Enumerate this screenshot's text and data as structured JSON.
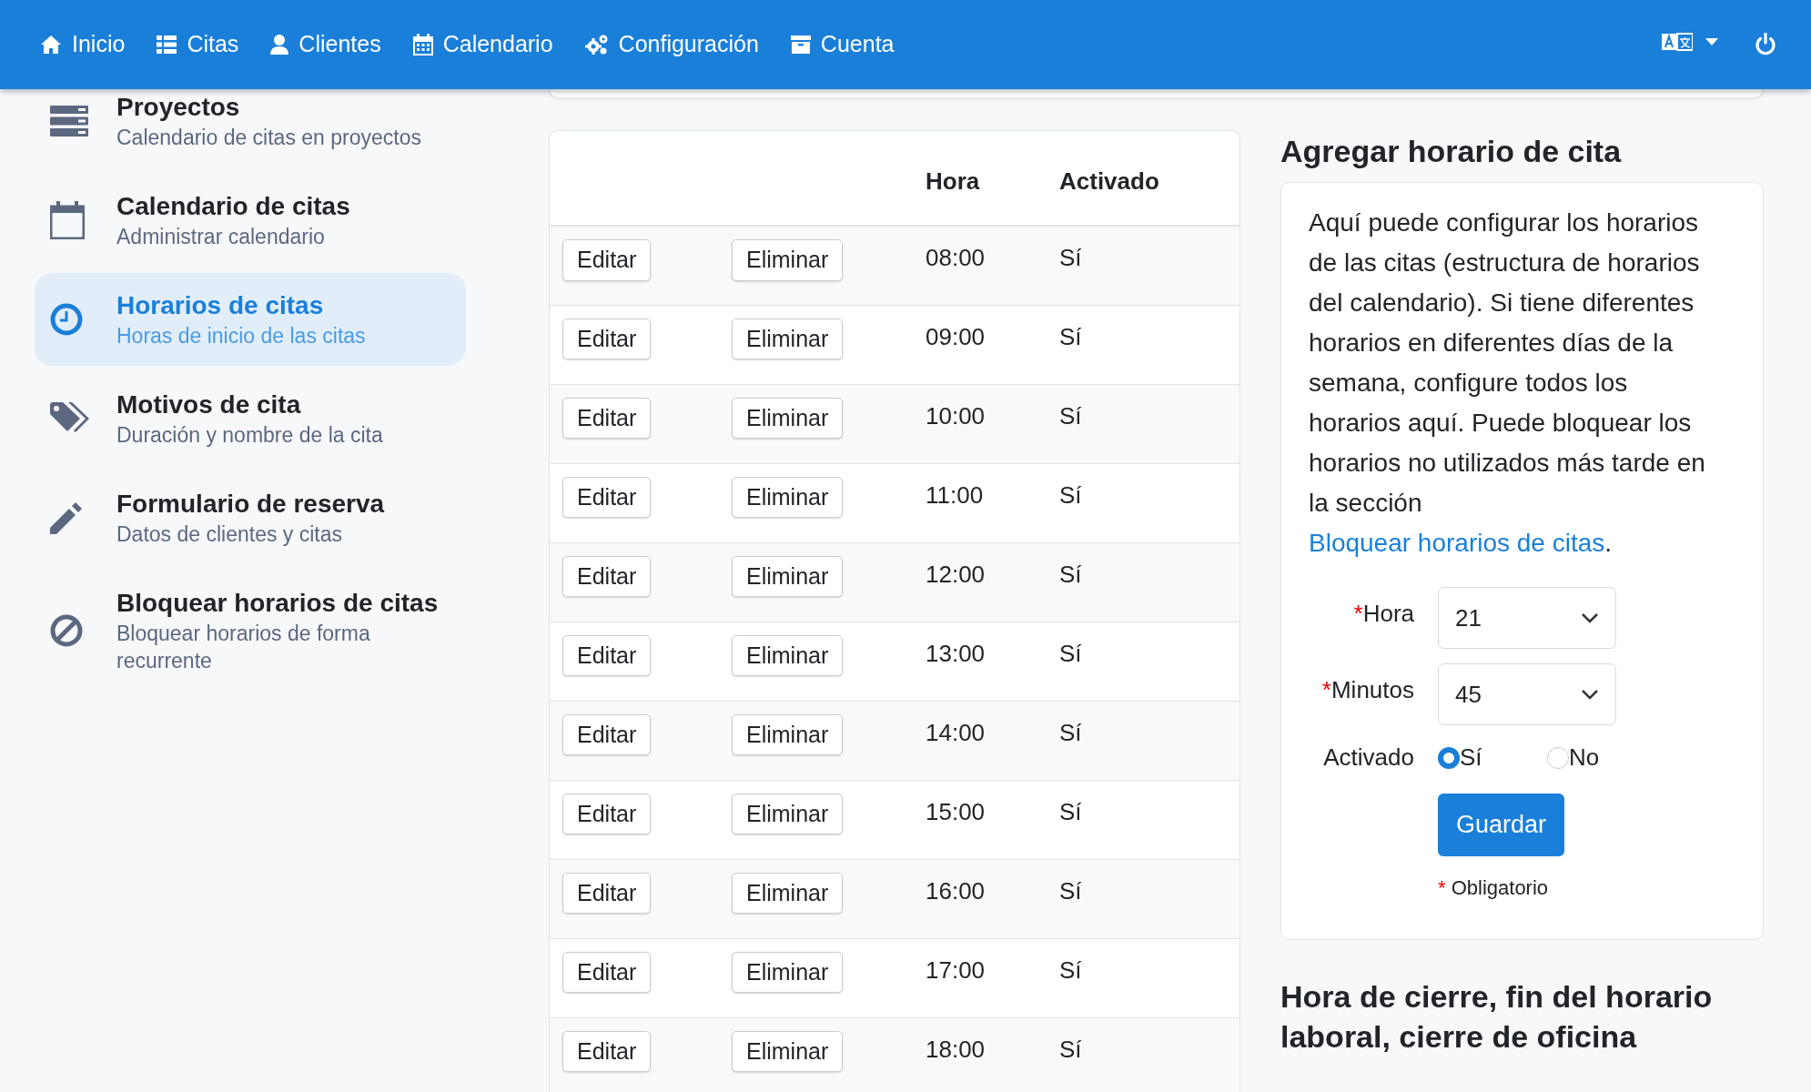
{
  "navbar": {
    "items": [
      {
        "label": "Inicio"
      },
      {
        "label": "Citas"
      },
      {
        "label": "Clientes"
      },
      {
        "label": "Calendario"
      },
      {
        "label": "Configuración"
      },
      {
        "label": "Cuenta"
      }
    ]
  },
  "sidebar": {
    "items": [
      {
        "title": "Proyectos",
        "subtitle": "Calendario de citas en proyectos",
        "selected": false
      },
      {
        "title": "Calendario de citas",
        "subtitle": "Administrar calendario",
        "selected": false
      },
      {
        "title": "Horarios de citas",
        "subtitle": "Horas de inicio de las citas",
        "selected": true
      },
      {
        "title": "Motivos de cita",
        "subtitle": "Duración y nombre de la cita",
        "selected": false
      },
      {
        "title": "Formulario de reserva",
        "subtitle": "Datos de clientes y citas",
        "selected": false
      },
      {
        "title": "Bloquear horarios de citas",
        "subtitle": "Bloquear horarios de forma recurrente",
        "selected": false
      }
    ]
  },
  "table": {
    "columns": [
      "Hora",
      "Activado"
    ],
    "rows": [
      {
        "edit": "Editar",
        "delete": "Eliminar",
        "hora": "08:00",
        "activado": "Sí"
      },
      {
        "edit": "Editar",
        "delete": "Eliminar",
        "hora": "09:00",
        "activado": "Sí"
      },
      {
        "edit": "Editar",
        "delete": "Eliminar",
        "hora": "10:00",
        "activado": "Sí"
      },
      {
        "edit": "Editar",
        "delete": "Eliminar",
        "hora": "11:00",
        "activado": "Sí"
      },
      {
        "edit": "Editar",
        "delete": "Eliminar",
        "hora": "12:00",
        "activado": "Sí"
      },
      {
        "edit": "Editar",
        "delete": "Eliminar",
        "hora": "13:00",
        "activado": "Sí"
      },
      {
        "edit": "Editar",
        "delete": "Eliminar",
        "hora": "14:00",
        "activado": "Sí"
      },
      {
        "edit": "Editar",
        "delete": "Eliminar",
        "hora": "15:00",
        "activado": "Sí"
      },
      {
        "edit": "Editar",
        "delete": "Eliminar",
        "hora": "16:00",
        "activado": "Sí"
      },
      {
        "edit": "Editar",
        "delete": "Eliminar",
        "hora": "17:00",
        "activado": "Sí"
      },
      {
        "edit": "Editar",
        "delete": "Eliminar",
        "hora": "18:00",
        "activado": "Sí"
      }
    ]
  },
  "form": {
    "title": "Agregar horario de cita",
    "description": "Aquí puede configurar los horarios de las citas (estructura de horarios del calendario). Si tiene diferentes horarios en diferentes días de la semana, configure todos los horarios aquí. Puede bloquear los horarios no utilizados más tarde en la sección",
    "link": "Bloquear horarios de citas",
    "after_link": ".",
    "fields": [
      {
        "mark": "*",
        "label": "Hora",
        "value": "21"
      },
      {
        "mark": "*",
        "label": "Minutos",
        "value": "45"
      }
    ],
    "radio": {
      "label": "Activado",
      "options": [
        {
          "label": "Sí",
          "selected": true
        },
        {
          "label": "No",
          "selected": false
        }
      ]
    },
    "button": "Guardar",
    "note": {
      "mark": "*",
      "text": "Obligatorio"
    }
  },
  "closing_heading": "Hora de cierre, fin del horario laboral, cierre de oficina"
}
